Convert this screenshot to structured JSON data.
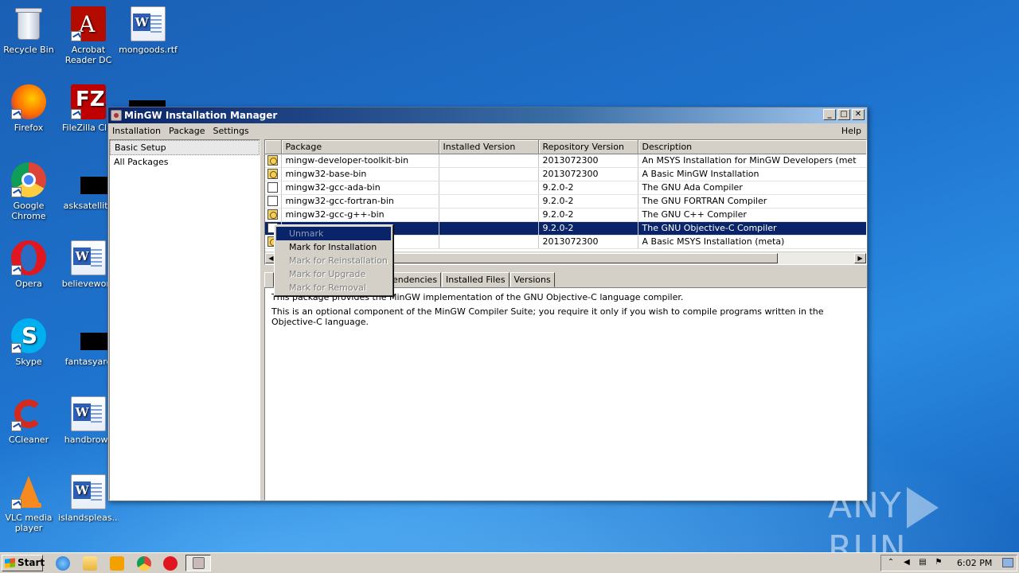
{
  "desktop": {
    "icons": [
      {
        "label": "Recycle Bin",
        "icon": "recycle-bin-icon"
      },
      {
        "label": "Acrobat Reader DC",
        "icon": "acrobat-icon"
      },
      {
        "label": "mongoods.rtf",
        "icon": "word-doc-icon"
      },
      {
        "label": "Firefox",
        "icon": "firefox-icon"
      },
      {
        "label": "FileZilla Clie",
        "icon": "filezilla-icon"
      },
      {
        "label": "Google Chrome",
        "icon": "chrome-icon"
      },
      {
        "label": "asksatellite",
        "icon": "black-file-icon"
      },
      {
        "label": "Opera",
        "icon": "opera-icon"
      },
      {
        "label": "believework",
        "icon": "word-doc-icon"
      },
      {
        "label": "Skype",
        "icon": "skype-icon"
      },
      {
        "label": "fantasyare",
        "icon": "black-file-icon"
      },
      {
        "label": "CCleaner",
        "icon": "ccleaner-icon"
      },
      {
        "label": "handbrows",
        "icon": "word-doc-icon"
      },
      {
        "label": "VLC media player",
        "icon": "vlc-icon"
      },
      {
        "label": "islandspleas...",
        "icon": "word-doc-icon"
      }
    ]
  },
  "window": {
    "title": "MinGW Installation Manager",
    "menu": [
      "Installation",
      "Package",
      "Settings"
    ],
    "help": "Help",
    "sidebar": [
      "Basic Setup",
      "All Packages"
    ],
    "columns": [
      "Package",
      "Installed Version",
      "Repository Version",
      "Description"
    ],
    "rows": [
      {
        "pkg": "mingw-developer-toolkit-bin",
        "installed": "",
        "repo": "2013072300",
        "desc": "An MSYS Installation for MinGW Developers (met",
        "state": "installed"
      },
      {
        "pkg": "mingw32-base-bin",
        "installed": "",
        "repo": "2013072300",
        "desc": "A Basic MinGW Installation",
        "state": "installed"
      },
      {
        "pkg": "mingw32-gcc-ada-bin",
        "installed": "",
        "repo": "9.2.0-2",
        "desc": "The GNU Ada Compiler",
        "state": "empty"
      },
      {
        "pkg": "mingw32-gcc-fortran-bin",
        "installed": "",
        "repo": "9.2.0-2",
        "desc": "The GNU FORTRAN Compiler",
        "state": "empty"
      },
      {
        "pkg": "mingw32-gcc-g++-bin",
        "installed": "",
        "repo": "9.2.0-2",
        "desc": "The GNU C++ Compiler",
        "state": "installed"
      },
      {
        "pkg": "",
        "installed": "",
        "repo": "9.2.0-2",
        "desc": "The GNU Objective-C Compiler",
        "state": "empty",
        "selected": true
      },
      {
        "pkg": "",
        "installed": "",
        "repo": "2013072300",
        "desc": "A Basic MSYS Installation (meta)",
        "state": "installed"
      }
    ],
    "tabs": [
      "",
      "pendencies",
      "Installed Files",
      "Versions"
    ],
    "description": [
      "This package provides the MinGW implementation of the GNU Objective-C language compiler.",
      "This is an optional component of the MinGW Compiler Suite; you require it only if you wish to compile programs written in the Objective-C language."
    ],
    "context_menu": [
      {
        "label": "Unmark",
        "enabled": false,
        "highlighted": true
      },
      {
        "label": "Mark for Installation",
        "enabled": true
      },
      {
        "label": "Mark for Reinstallation",
        "enabled": false
      },
      {
        "label": "Mark for Upgrade",
        "enabled": false
      },
      {
        "label": "Mark for Removal",
        "enabled": false
      }
    ]
  },
  "taskbar": {
    "start_label": "Start",
    "clock": "6:02 PM"
  },
  "watermark": {
    "left": "ANY",
    "right": "RUN"
  }
}
